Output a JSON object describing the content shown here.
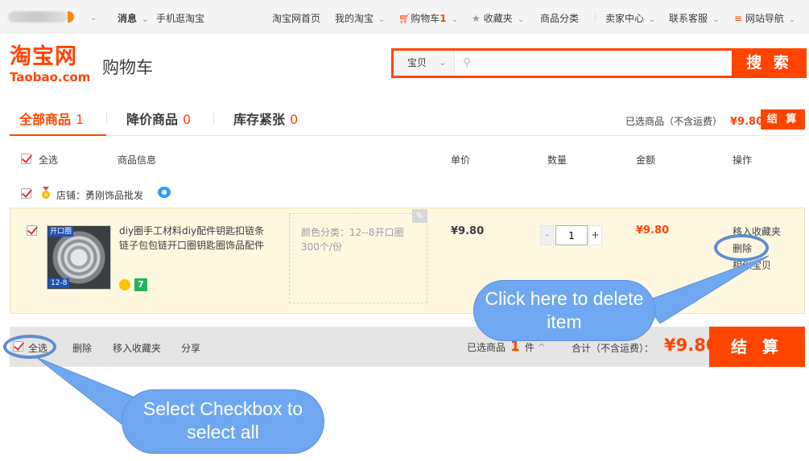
{
  "topnav": {
    "messages": "消息",
    "mobile": "手机逛淘宝",
    "home": "淘宝网首页",
    "my_taobao": "我的淘宝",
    "cart_label": "购物车",
    "cart_count": "1",
    "favorites": "收藏夹",
    "categories": "商品分类",
    "seller_center": "卖家中心",
    "support": "联系客服",
    "site_nav": "网站导航"
  },
  "header": {
    "logo_cn": "淘宝网",
    "logo_en": "Taobao.com",
    "page_title": "购物车",
    "search_category": "宝贝",
    "search_button": "搜 索"
  },
  "tabs": [
    {
      "label": "全部商品",
      "count": "1"
    },
    {
      "label": "降价商品",
      "count": "0"
    },
    {
      "label": "库存紧张",
      "count": "0"
    }
  ],
  "summary": {
    "selected_label": "已选商品（不含运费）",
    "selected_amount": "¥9.80",
    "checkout": "结 算"
  },
  "columns": {
    "select_all": "全选",
    "info": "商品信息",
    "unit_price": "单价",
    "quantity": "数量",
    "amount": "金额",
    "actions": "操作"
  },
  "shop": {
    "label": "店铺：勇刚饰品批发"
  },
  "item": {
    "image_tag_top": "开口圈",
    "image_tag_bottom": "12-8",
    "title": "diy圈手工材料diy配件钥匙扣链条链子包包链开口圈钥匙圈饰品配件",
    "badge": "7",
    "sku": "颜色分类：12--8开口圈300个/份",
    "unit_price": "¥9.80",
    "quantity": "1",
    "minus": "-",
    "plus": "+",
    "amount": "¥9.80",
    "action_favorite": "移入收藏夹",
    "action_delete": "删除",
    "action_similar": "相似宝贝"
  },
  "bottom": {
    "select_all": "全选",
    "delete": "删除",
    "move_fav": "移入收藏夹",
    "share": "分享",
    "selected_prefix": "已选商品",
    "selected_count": "1",
    "selected_suffix": "件",
    "expand": "^",
    "total_label": "合计（不含运费）：",
    "total": "¥9.80",
    "checkout": "结 算"
  },
  "callouts": {
    "delete_hint": "Click here to delete item",
    "select_hint": "Select Checkbox to select all"
  },
  "colors": {
    "accent": "#ff4400",
    "callout": "#6fa8f0"
  }
}
